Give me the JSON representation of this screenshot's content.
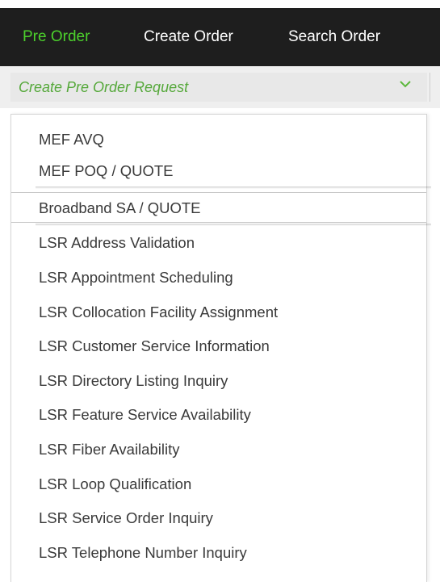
{
  "nav": {
    "tabs": [
      {
        "label": "Pre Order",
        "active": true
      },
      {
        "label": "Create Order",
        "active": false
      },
      {
        "label": "Search Order",
        "active": false
      }
    ]
  },
  "dropdown": {
    "selected": "Create Pre Order Request",
    "icon": "chevron-down-icon",
    "options": [
      "MEF AVQ",
      "MEF POQ / QUOTE",
      "Broadband SA / QUOTE",
      "LSR Address Validation",
      "LSR Appointment Scheduling",
      "LSR Collocation Facility Assignment",
      "LSR Customer Service Information",
      "LSR Directory Listing Inquiry",
      "LSR Feature Service Availability",
      "LSR Fiber Availability",
      "LSR Loop Qualification",
      "LSR Service Order Inquiry",
      "LSR Telephone Number Inquiry"
    ]
  },
  "colors": {
    "nav_bg": "#1e1e1e",
    "accent": "#4cd12c",
    "select_label": "#55a83a"
  }
}
